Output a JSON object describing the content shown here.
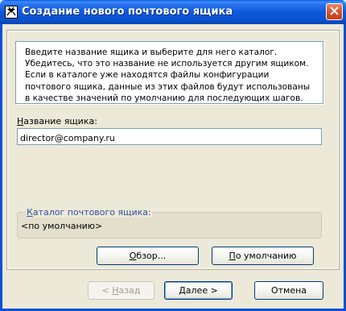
{
  "window": {
    "title": "Создание нового почтового ящика"
  },
  "info": {
    "text": "Введите название ящика и выберите для него каталог. Убедитесь, что это название не используется другим ящиком. Если в каталоге уже находятся файлы конфигурации почтового ящика, данные из этих файлов будут использованы в качестве значений по умолчанию для последующих шагов."
  },
  "mailbox": {
    "name_label": "Название ящика:",
    "name_value": "director@company.ru"
  },
  "catalog": {
    "label": "Каталог почтового ящика:",
    "value": "<по умолчанию>"
  },
  "buttons": {
    "browse": "Обзор...",
    "default": "По умолчанию",
    "back": "< Назад",
    "next": "Далее >",
    "cancel": "Отмена"
  },
  "colors": {
    "titlebar": "#0A52CF",
    "dialog_bg": "#ECE9D8",
    "group_label": "#2F4F9F"
  }
}
